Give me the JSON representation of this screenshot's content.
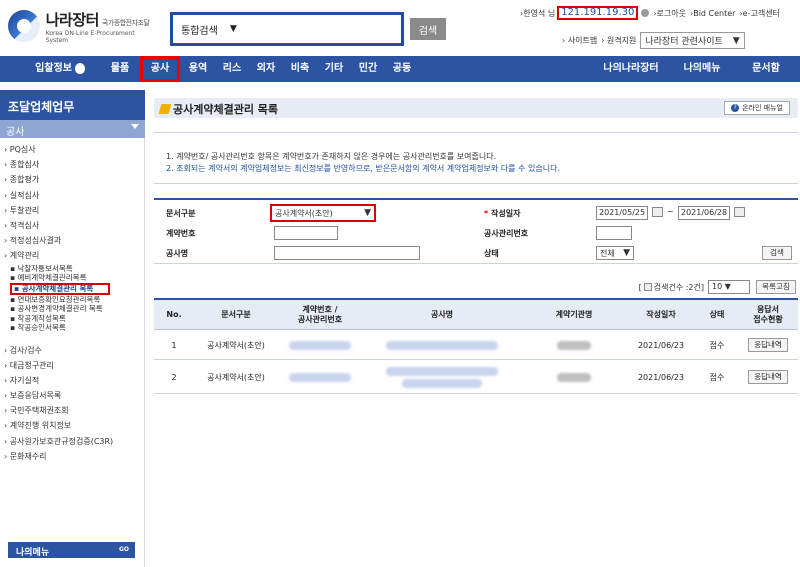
{
  "header": {
    "logo_title": "나라장터",
    "logo_small": "국가종합전자조달",
    "logo_sub": "Korea ON-Line E-Procurement System",
    "search_select": "통합검색",
    "search_button": "검색",
    "user_greeting": "›한영석 님",
    "ip": "121.191.19.30",
    "logout": "›로그아웃",
    "bid_center": "›Bid Center",
    "customer_center": "›e-고객센터",
    "sitemap": "› 사이트맵",
    "remote_support": "› 원격지원",
    "related_sites": "나라장터 관련사이트"
  },
  "nav": {
    "items": [
      "입찰정보",
      "물품",
      "공사",
      "용역",
      "리스",
      "외자",
      "비축",
      "기타",
      "민간",
      "공동"
    ],
    "right_items": [
      "나의나라장터",
      "나의메뉴",
      "문서함"
    ]
  },
  "sidebar": {
    "title": "조달업체업무",
    "category": "공사",
    "items_top": [
      "› PQ심사",
      "› 종합심사",
      "› 종합평가",
      "› 실적심사",
      "› 투찰관리",
      "› 적격심사",
      "› 적정성심사결과",
      "› 계약관리"
    ],
    "sub_items": [
      "▪ 낙찰자통보서목록",
      "▪ 예비계약체결관리목록",
      "▪ 공사계약체결관리 목록",
      "▪ 연대보증확인요청관리목록",
      "▪ 공사변경계약체결관리 목록",
      "▪ 착공계작성목록",
      "▪ 착공승인서목록"
    ],
    "items_bottom": [
      "› 검사/검수",
      "› 대금청구관리",
      "› 자기실적",
      "› 보증응답서목록",
      "› 국민주택채권조회",
      "› 계약진행 위치정보",
      "› 공사원가보호관규정검증(C3R)",
      "› 문화재수리"
    ],
    "footer": "나의메뉴",
    "footer_go": "GO"
  },
  "main": {
    "title": "공사계약체결관리 목록",
    "manual_button": "온라인 매뉴얼",
    "notice_1": "1. 계약번호/ 공사관리번호 항목은 계약번호가 존재하지 않은 경우에는 공사관리번호를 보여줍니다.",
    "notice_2": "2. 조회되는 계약서의 계약업체정보는 최신정보를 반영하므로, 받은문서함의 계약서 계약업체정보와 다를 수 있습니다."
  },
  "form": {
    "doc_type_label": "문서구분",
    "doc_type_value": "공사계약서(초안)",
    "date_label": "작성일자",
    "date_from": "2021/05/25",
    "date_to": "2021/06/28",
    "contract_no_label": "계약번호",
    "mgmt_no_label": "공사관리번호",
    "name_label": "공사명",
    "status_label": "상태",
    "status_value": "전체",
    "search_button": "검색",
    "required_mark": "*",
    "tilde": "~"
  },
  "results": {
    "count_text": "검색건수 :2건]",
    "count_prefix": "[",
    "page_size": "10",
    "list_button": "목록고침"
  },
  "table": {
    "headers": [
      "No.",
      "문서구분",
      "계약번호 /\n공사관리번호",
      "공사명",
      "계약기관명",
      "작성일자",
      "상태",
      "응답서\n접수현황"
    ],
    "rows": [
      {
        "no": "1",
        "doc_type": "공사계약서(초안)",
        "date": "2021/06/23",
        "status": "접수",
        "action": "응답내역"
      },
      {
        "no": "2",
        "doc_type": "공사계약서(초안)",
        "date": "2021/06/23",
        "status": "접수",
        "action": "응답내역"
      }
    ]
  }
}
